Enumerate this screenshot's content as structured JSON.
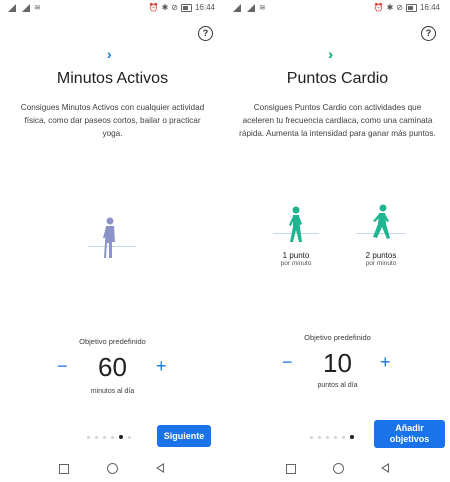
{
  "status_bar": {
    "time": "16:44"
  },
  "left_screen": {
    "title": "Minutos Activos",
    "description": "Consigues Minutos Activos con cualquier actividad física, como dar paseos cortos, bailar o practicar yoga.",
    "goal_label": "Objetivo predefinido",
    "goal_value": "60",
    "goal_unit": "minutos al día",
    "minus_label": "−",
    "plus_label": "+",
    "next_button": "Siguiente",
    "page_dots": 6,
    "active_dot": 4
  },
  "right_screen": {
    "title": "Puntos Cardio",
    "description": "Consigues Puntos Cardio con actividades que aceleren tu frecuencia cardiaca, como una caminata rápida. Aumenta la intensidad para ganar más puntos.",
    "figure1_caption": "1 punto",
    "figure1_sub": "por minuto",
    "figure2_caption": "2 puntos",
    "figure2_sub": "por minuto",
    "goal_label": "Objetivo predefinido",
    "goal_value": "10",
    "goal_unit": "puntos al día",
    "minus_label": "−",
    "plus_label": "+",
    "add_button_line1": "Añadir",
    "add_button_line2": "objetivos",
    "page_dots": 6,
    "active_dot": 5
  },
  "colors": {
    "accent_blue": "#1a73e8",
    "cardio_green": "#1fb591",
    "minutes_figure": "#8b93c7"
  },
  "icons": [
    "help-icon",
    "chevron-right-icon",
    "double-chevron-icon",
    "nav-recents-icon",
    "nav-home-icon",
    "nav-back-icon"
  ]
}
